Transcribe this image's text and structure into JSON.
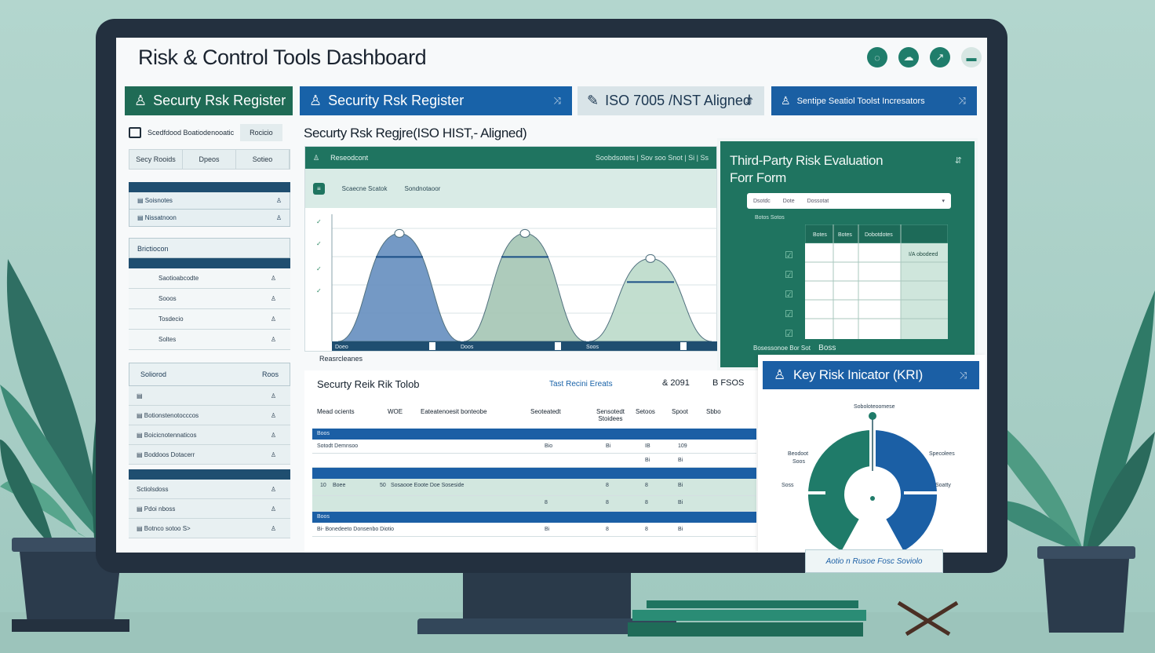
{
  "header": {
    "title": "Risk & Control Tools Dashboard",
    "icons": [
      "chat-icon",
      "cloud-icon",
      "share-icon",
      "menu-icon"
    ]
  },
  "tabs": [
    {
      "label": "Securty Rsk Register",
      "icon": "person-icon"
    },
    {
      "label": "Security Rsk Register",
      "icon": "person-icon",
      "tail": "⤨"
    },
    {
      "label": "ISO 7005 /NST Aligned",
      "icon": "pen-icon",
      "tail": "⇵"
    },
    {
      "label": "Sentipe Seatiol Toolst Incresators",
      "icon": "person-icon",
      "tail": "⤨"
    }
  ],
  "nav": {
    "top_label": "Scedfdood Boatiodenooatic",
    "top_chip": "Rocicio",
    "tabs": [
      "Secy Rooids",
      "Dpeos",
      "Sotieo"
    ],
    "rows_a": [
      "Soisnotes",
      "Nissatnoon"
    ],
    "section": "Brictiocon",
    "rows_b": [
      "Saotioabcodte",
      "Sooos",
      "Tosdecio",
      "Soltes"
    ],
    "section2_left": "Soliorod",
    "section2_right": "Roos",
    "rows_c": [
      "",
      "Botionstenotocccos",
      "Boicicnotennaticos",
      "Boddoos Dotacerr"
    ],
    "rows_d": [
      "Sctiolsdoss",
      "Pdoi nboss",
      "Botnco sotoo S>"
    ]
  },
  "center": {
    "title": "Securty Rsk Regjre(ISO HIST,- Aligned)",
    "bar_label": "Reseodcont",
    "bar_meta": "Soobdsotets | Sov soo Snot | Si | Ss",
    "sub_pill": "≡",
    "sub_a": "Scaecne Scatok",
    "sub_b": "Sondnotaoor",
    "foot": "Reasrcleanes"
  },
  "chart_data": {
    "type": "area",
    "title": "",
    "categories": [
      "Doeo",
      "Doos",
      "Soos"
    ],
    "series": [
      {
        "values": [
          0,
          0.86,
          0
        ]
      },
      {
        "values": [
          0,
          0.86,
          0
        ]
      },
      {
        "values": [
          0,
          0.66,
          0
        ]
      }
    ],
    "colors": [
      "#6d94c2",
      "#a9c8b7",
      "#bfdccc"
    ]
  },
  "table": {
    "title": "Securty Reik Rik Tolob",
    "link": "Tast Recini Ereats",
    "year": "& 2091",
    "cur": "B FSOS",
    "headers": [
      "Mead ocients",
      "WOE",
      "Eateatenoesit bonteobe",
      "Seoteatedt",
      "Sensotedt Stoidees",
      "Setoos",
      "Spoot",
      "Sbbo"
    ],
    "band1": "Boos",
    "row1": [
      "Sotodt Demnsoo",
      "",
      "Bio",
      "",
      "Bi",
      "",
      "IB",
      "109"
    ],
    "row2": [
      "",
      "",
      "",
      "",
      "",
      "",
      "Bi",
      "Bi"
    ],
    "row3": [
      "10",
      "Boee",
      "50",
      "Sosaooe Eoote Doe Soseside"
    ],
    "row3_vals": [
      "",
      "",
      "",
      "",
      "8",
      "8",
      "Bi"
    ],
    "row4_vals": [
      "8",
      "8",
      "8",
      "Bi"
    ],
    "band2": "Boos",
    "row5": "Bi- Bonedeeto Donsenbo Diotio",
    "row5_vals": [
      "Bi",
      "8",
      "8",
      "Bi"
    ]
  },
  "third_party": {
    "title_line1": "Third-Party Risk Evaluation",
    "title_line2": "Forr Form",
    "field_a": "Dsotdc",
    "field_b": "Dote",
    "field_c": "Dossotat",
    "label": "Botos Sotos",
    "grid_headers": [
      "Botes",
      "Botes",
      "Dobotdotes"
    ],
    "grid_right": "I/A obodeed",
    "foot_a": "Bosessonoe Bor Sot",
    "foot_b": "Boss"
  },
  "kri": {
    "title": "Key Risk Inicator (KRI)",
    "label_top": "Soboloteoomese",
    "label_left1": "Beodoot",
    "label_left2": "Soos",
    "label_left3": "Soss",
    "label_right1": "Specolees",
    "label_right2": "Soatty",
    "gauge_value": 0.42,
    "colors": {
      "teal": "#1f7b69",
      "blue": "#1b5fa5"
    }
  },
  "note_card": "Aotio n Rusoe Fosc Soviolo"
}
